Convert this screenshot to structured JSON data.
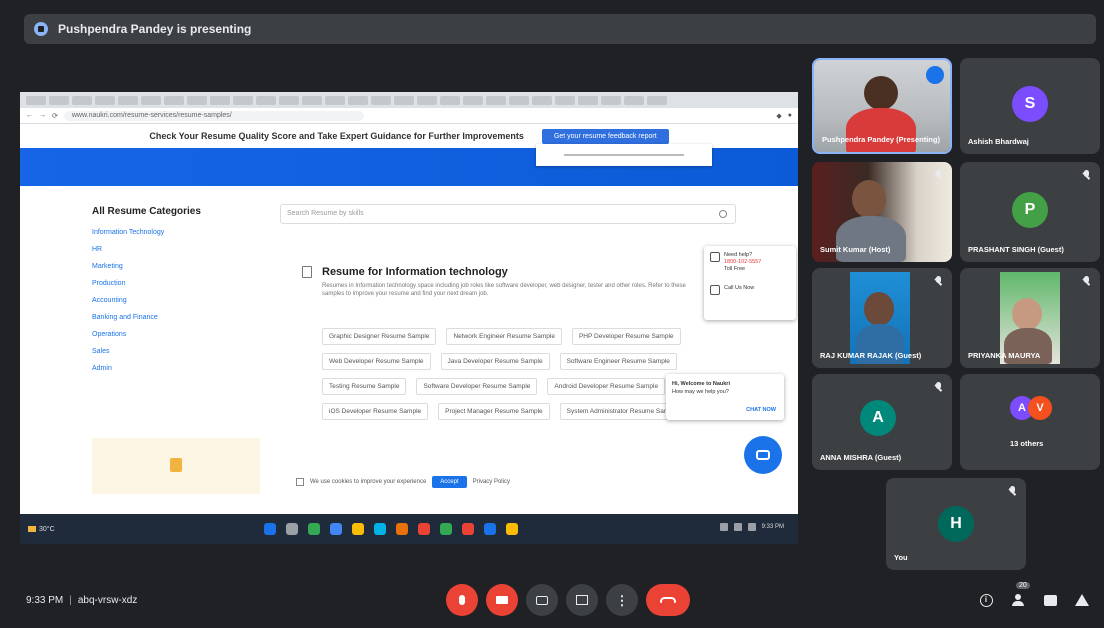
{
  "presenting": {
    "text": "Pushpendra Pandey is presenting"
  },
  "shared_screen": {
    "url": "www.naukri.com/resume-services/resume-samples/",
    "banner_text": "Check Your Resume Quality Score and Take Expert Guidance for Further Improvements",
    "banner_button": "Get your resume feedback report",
    "categories_title": "All Resume Categories",
    "categories": [
      "Information Technology",
      "HR",
      "Marketing",
      "Production",
      "Accounting",
      "Banking and Finance",
      "Operations",
      "Sales",
      "Admin"
    ],
    "search_placeholder": "Search Resume by skills",
    "section_title": "Resume for Information technology",
    "section_desc": "Resumes in Information technology space including job roles like software developer, web designer, tester and other roles. Refer to these samples to improve your resume and find your next dream job.",
    "chips": [
      "Graphic Designer Resume Sample",
      "Network Engineer Resume Sample",
      "PHP Developer Resume Sample",
      "Web Developer Resume Sample",
      "Java Developer Resume Sample",
      "Software Engineer Resume Sample",
      "Testing Resume Sample",
      "Software Developer Resume Sample",
      "Android Developer Resume Sample",
      "iOS Developer Resume Sample",
      "Project Manager Resume Sample",
      "System Administrator Resume Sample"
    ],
    "contact_line1": "Need help?",
    "contact_line2": "1800-102-5557",
    "contact_line3": "Toll Free",
    "contact_line4": "Call Us Now",
    "help_title": "Hi, Welcome to Naukri",
    "help_text": "How may we help you?",
    "help_cta": "CHAT NOW",
    "cookie_text": "We use cookies to improve your experience",
    "cookie_accept": "Accept",
    "cookie_policy": "Privacy Policy"
  },
  "taskbar": {
    "weather": "30°C",
    "time": "9:33 PM",
    "icon_colors": [
      "#1a73e8",
      "#9aa0a6",
      "#34a853",
      "#4285f4",
      "#fbbc04",
      "#00b3e6",
      "#e8710a",
      "#ea4335",
      "#34a853",
      "#ea4335",
      "#1a73e8",
      "#fbbc04"
    ]
  },
  "participants": [
    {
      "name": "Pushpendra Pandey (Presenting)",
      "type": "video"
    },
    {
      "name": "Ashish Bhardwaj",
      "type": "avatar",
      "initial": "S",
      "color": "#7c4dff"
    },
    {
      "name": "Sumit Kumar (Host)",
      "type": "video"
    },
    {
      "name": "PRASHANT SINGH (Guest)",
      "type": "avatar",
      "initial": "P",
      "color": "#43a047"
    },
    {
      "name": "RAJ KUMAR RAJAK (Guest)",
      "type": "video"
    },
    {
      "name": "PRIYANKA MAURYA",
      "type": "video"
    },
    {
      "name": "ANNA MISHRA (Guest)",
      "type": "avatar",
      "initial": "A",
      "color": "#00897b"
    },
    {
      "name": "13 others",
      "type": "group",
      "initials": [
        "A",
        "V"
      ],
      "colors": [
        "#7c4dff",
        "#f4511e"
      ]
    },
    {
      "name": "You",
      "type": "avatar",
      "initial": "H",
      "color": "#00695c"
    }
  ],
  "meeting": {
    "time": "9:33 PM",
    "code": "abq-vrsw-xdz",
    "participant_count": "20"
  }
}
